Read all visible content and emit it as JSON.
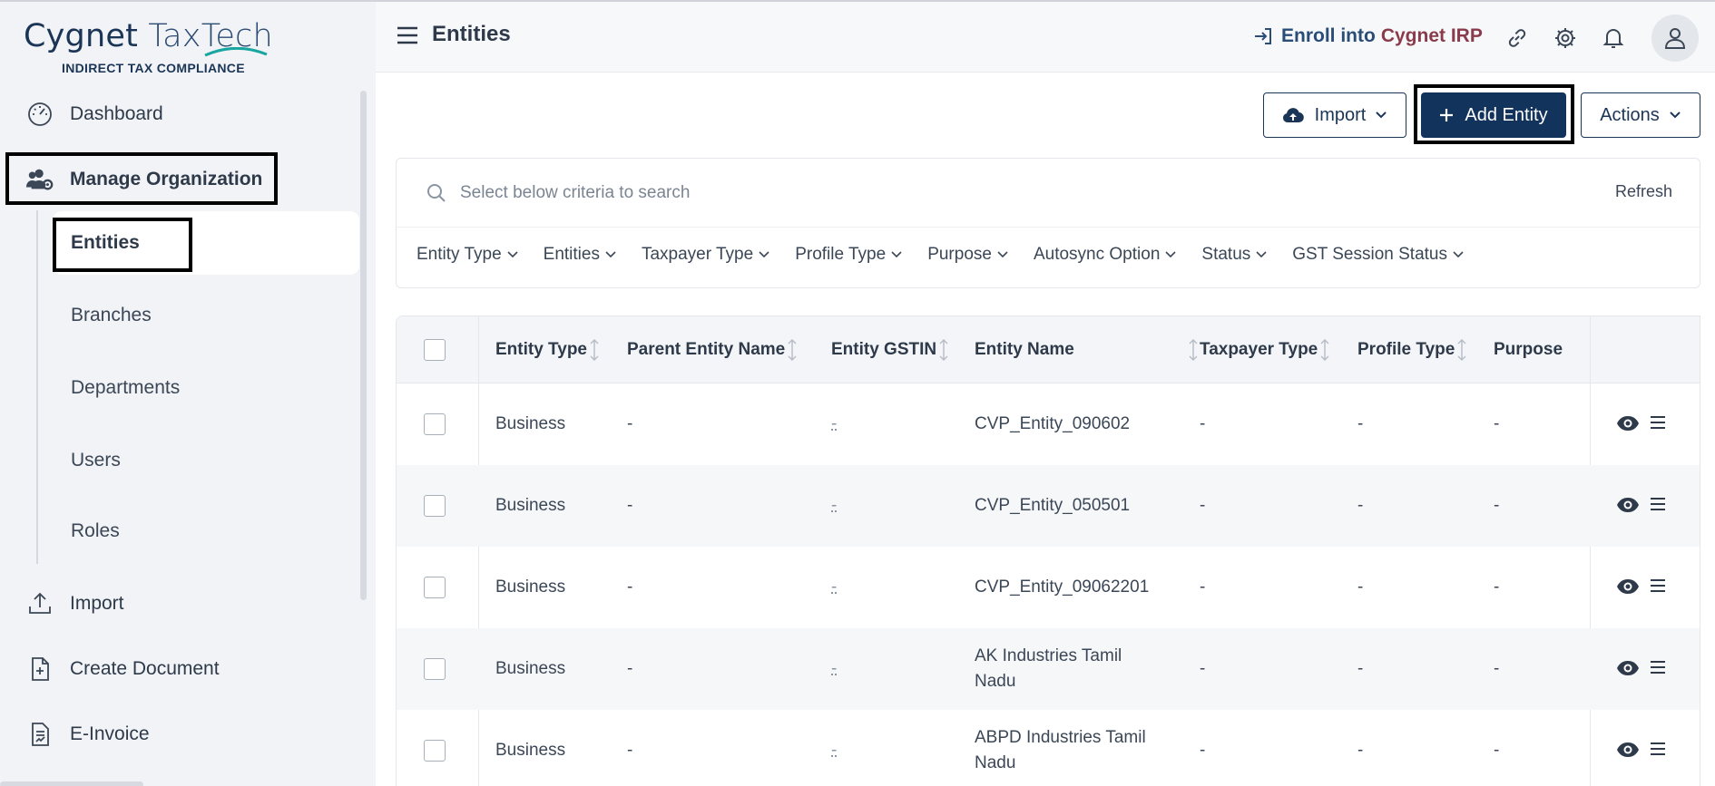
{
  "app": {
    "brand_main": "Cygnet",
    "brand_light": "TaxTech",
    "brand_sub": "INDIRECT TAX COMPLIANCE"
  },
  "sidebar": {
    "items": [
      {
        "label": "Dashboard",
        "icon": "dashboard-gauge-icon"
      },
      {
        "label": "Manage Organization",
        "icon": "users-gear-icon"
      },
      {
        "label": "Import",
        "icon": "upload-tray-icon"
      },
      {
        "label": "Create Document",
        "icon": "document-plus-icon"
      },
      {
        "label": "E-Invoice",
        "icon": "invoice-document-icon"
      }
    ],
    "sub_items": [
      {
        "label": "Entities",
        "selected": true
      },
      {
        "label": "Branches"
      },
      {
        "label": "Departments"
      },
      {
        "label": "Users"
      },
      {
        "label": "Roles"
      }
    ]
  },
  "header": {
    "title": "Entities",
    "enroll_label": "Enroll into",
    "enroll_brand": "Cygnet IRP",
    "icons": [
      "link-icon",
      "gear-icon",
      "bell-icon",
      "user-icon"
    ]
  },
  "toolbar": {
    "import_label": "Import",
    "add_label": "Add Entity",
    "actions_label": "Actions"
  },
  "search": {
    "placeholder": "Select below criteria to search",
    "refresh_label": "Refresh"
  },
  "filters": [
    "Entity Type",
    "Entities",
    "Taxpayer Type",
    "Profile Type",
    "Purpose",
    "Autosync Option",
    "Status",
    "GST Session Status"
  ],
  "table": {
    "columns": [
      "Entity Type",
      "Parent Entity Name",
      "Entity GSTIN",
      "Entity Name",
      "Taxpayer Type",
      "Profile Type",
      "Purpose"
    ],
    "rows": [
      {
        "entity_type": "Business",
        "parent": "-",
        "gstin": "-",
        "name": "CVP_Entity_090602",
        "taxpayer": "-",
        "profile": "-",
        "purpose": "-"
      },
      {
        "entity_type": "Business",
        "parent": "-",
        "gstin": "-",
        "name": "CVP_Entity_050501",
        "taxpayer": "-",
        "profile": "-",
        "purpose": "-"
      },
      {
        "entity_type": "Business",
        "parent": "-",
        "gstin": "-",
        "name": "CVP_Entity_09062201",
        "taxpayer": "-",
        "profile": "-",
        "purpose": "-"
      },
      {
        "entity_type": "Business",
        "parent": "-",
        "gstin": "-",
        "name": "AK Industries Tamil Nadu",
        "taxpayer": "-",
        "profile": "-",
        "purpose": "-"
      },
      {
        "entity_type": "Business",
        "parent": "-",
        "gstin": "-",
        "name": "ABPD Industries Tamil Nadu",
        "taxpayer": "-",
        "profile": "-",
        "purpose": "-"
      }
    ]
  },
  "colors": {
    "primary": "#12335b",
    "sidebar_bg": "#f1f3f6",
    "irp_accent": "#8a3b4b"
  }
}
